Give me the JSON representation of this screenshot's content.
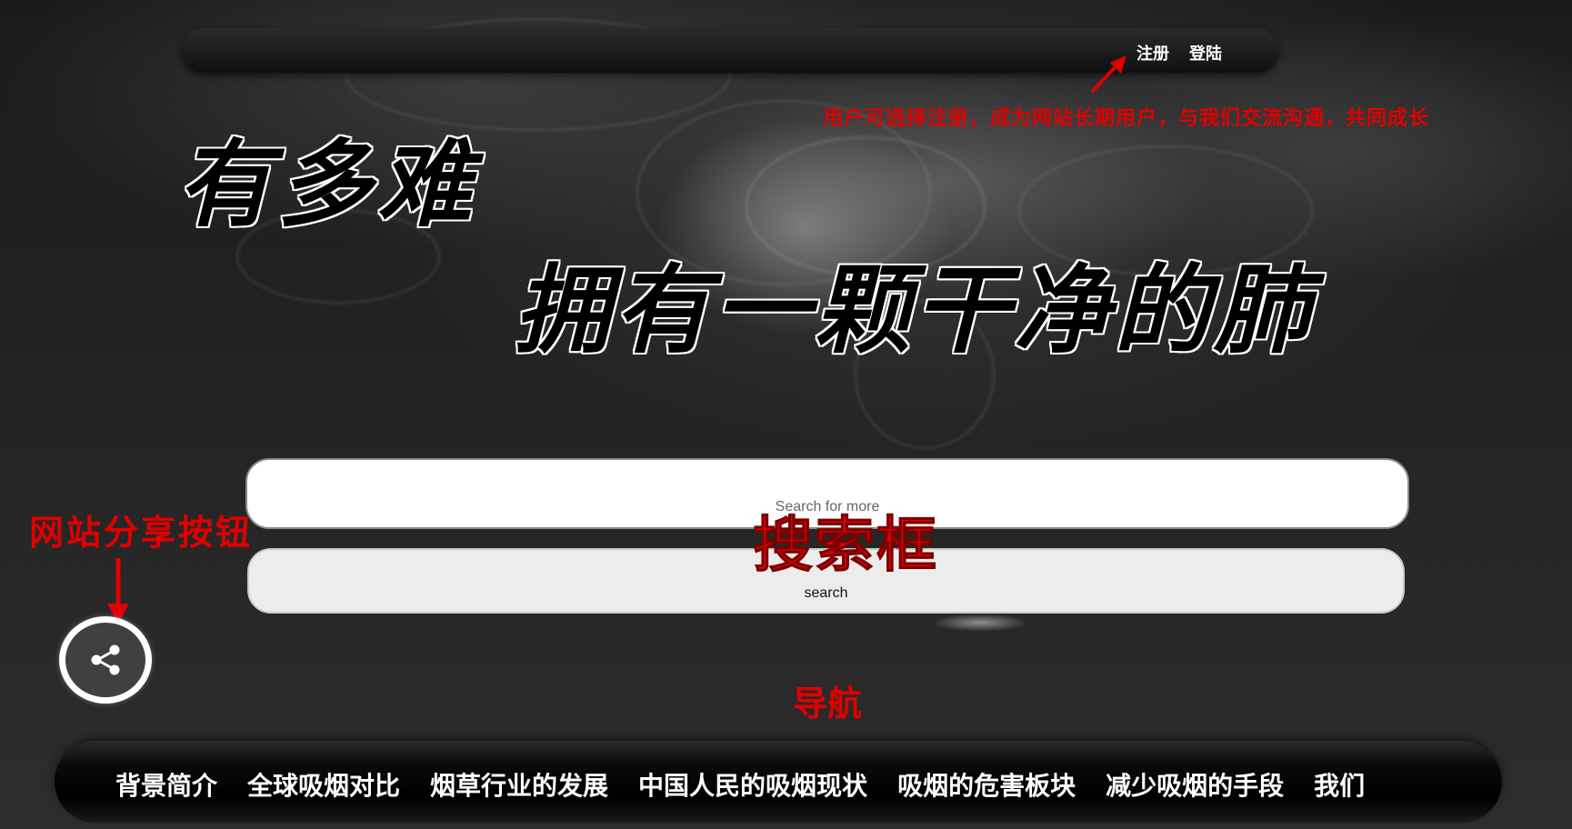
{
  "header": {
    "register_label": "注册",
    "login_label": "登陆"
  },
  "title": {
    "line1": "有多难",
    "line2": "拥有一颗干净的肺"
  },
  "search": {
    "placeholder": "Search for more",
    "button_label": "search"
  },
  "annotations": {
    "register_note": "用户可选择注册，成为网站长期用户，与我们交流沟通，共同成长",
    "share_note": "网站分享按钮",
    "search_note": "搜索框",
    "nav_note": "导航"
  },
  "share": {
    "icon": "share-icon"
  },
  "nav": {
    "items": [
      {
        "label": "背景简介"
      },
      {
        "label": "全球吸烟对比"
      },
      {
        "label": "烟草行业的发展"
      },
      {
        "label": "中国人民的吸烟现状"
      },
      {
        "label": "吸烟的危害板块"
      },
      {
        "label": "减少吸烟的手段"
      },
      {
        "label": "我们"
      }
    ]
  },
  "colors": {
    "annotation": "#e00000",
    "background": "#222222",
    "nav_text": "#ffffff"
  }
}
